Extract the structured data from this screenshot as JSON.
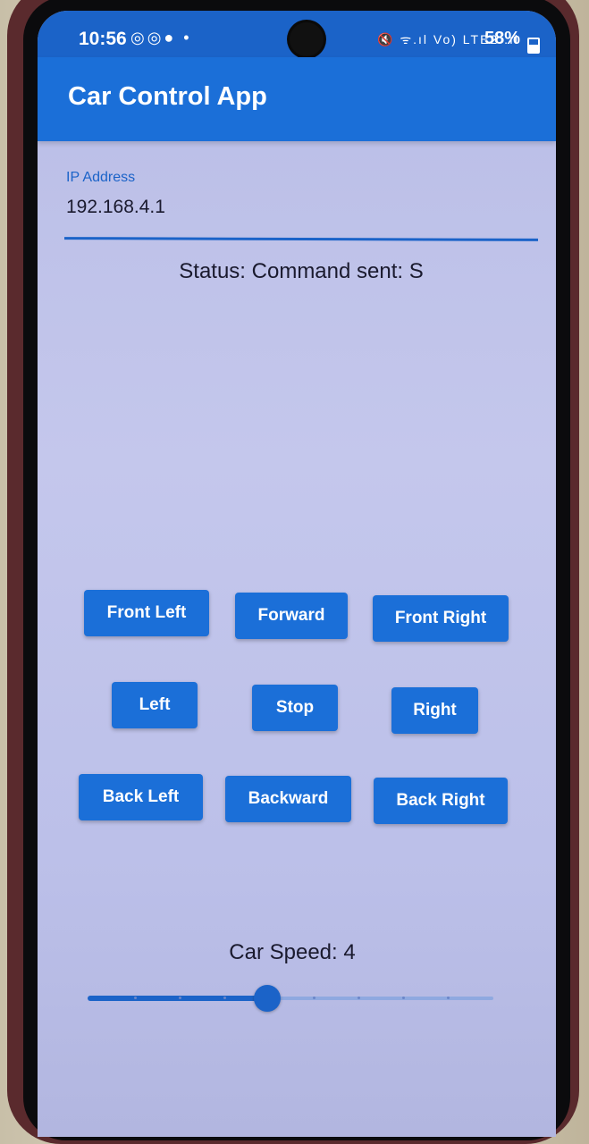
{
  "statusbar": {
    "time": "10:56",
    "left_icons": "◎◎● •",
    "right_icons": "🔇 ᯤ.ıl Vo) LTE2 .ıl",
    "battery": "58%"
  },
  "app": {
    "title": "Car Control App"
  },
  "ip_field": {
    "label": "IP Address",
    "value": "192.168.4.1"
  },
  "status": {
    "text": "Status: Command sent: S"
  },
  "controls": {
    "front_left": "Front Left",
    "forward": "Forward",
    "front_right": "Front Right",
    "left": "Left",
    "stop": "Stop",
    "right": "Right",
    "back_left": "Back Left",
    "backward": "Backward",
    "back_right": "Back Right"
  },
  "speed": {
    "label": "Car Speed: 4",
    "value": 4,
    "min": 0,
    "max": 10
  },
  "colors": {
    "primary": "#1b6fd8",
    "background": "#bfc3ea",
    "text": "#1a1a2e"
  }
}
